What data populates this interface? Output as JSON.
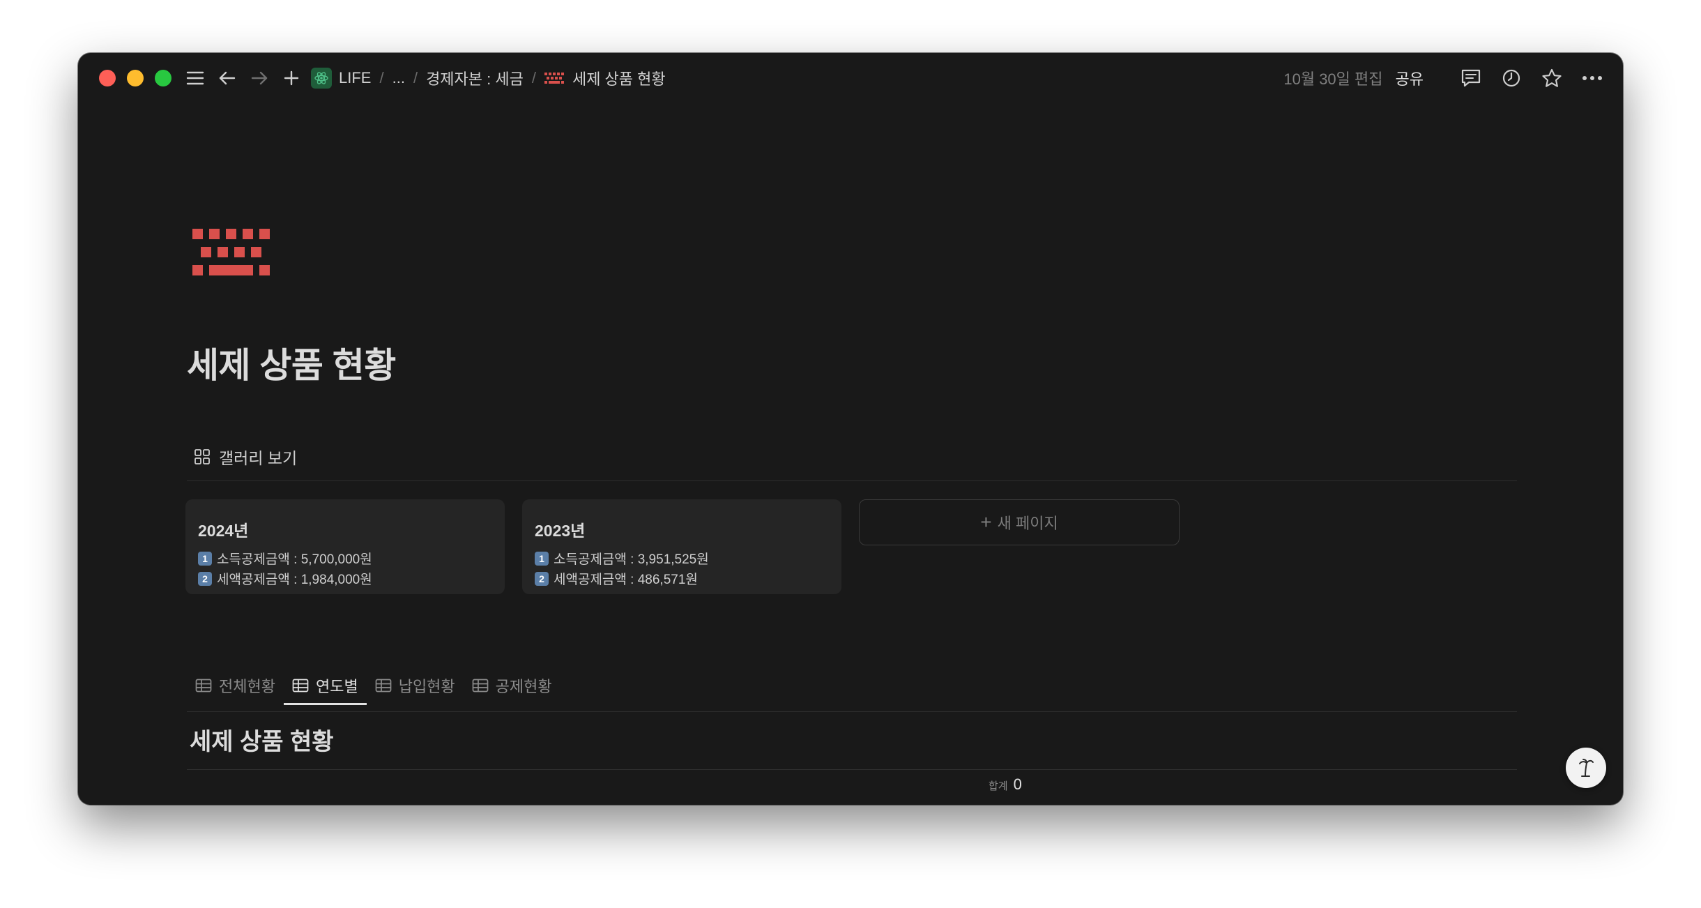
{
  "titlebar": {
    "breadcrumbs": [
      "LIFE",
      "...",
      "경제자본 : 세금",
      "세제 상품 현황"
    ],
    "edited": "10월 30일 편집",
    "share": "공유"
  },
  "page": {
    "title": "세제 상품 현황",
    "view_label": "갤러리 보기"
  },
  "cards": [
    {
      "title": "2024년",
      "line1_num": "1",
      "line1": "소득공제금액 : 5,700,000원",
      "line2_num": "2",
      "line2": "세액공제금액 : 1,984,000원"
    },
    {
      "title": "2023년",
      "line1_num": "1",
      "line1": "소득공제금액 : 3,951,525원",
      "line2_num": "2",
      "line2": "세액공제금액 : 486,571원"
    }
  ],
  "new_page_label": "새 페이지",
  "tabs": [
    {
      "label": "전체현황"
    },
    {
      "label": "연도별"
    },
    {
      "label": "납입현황"
    },
    {
      "label": "공제현황"
    }
  ],
  "active_tab": "연도별",
  "table": {
    "title": "세제 상품 현황",
    "sum_label": "합계",
    "sum_value": "0"
  },
  "colors": {
    "background": "#191919",
    "card": "#252525",
    "accent_icon": "#d9504c"
  }
}
